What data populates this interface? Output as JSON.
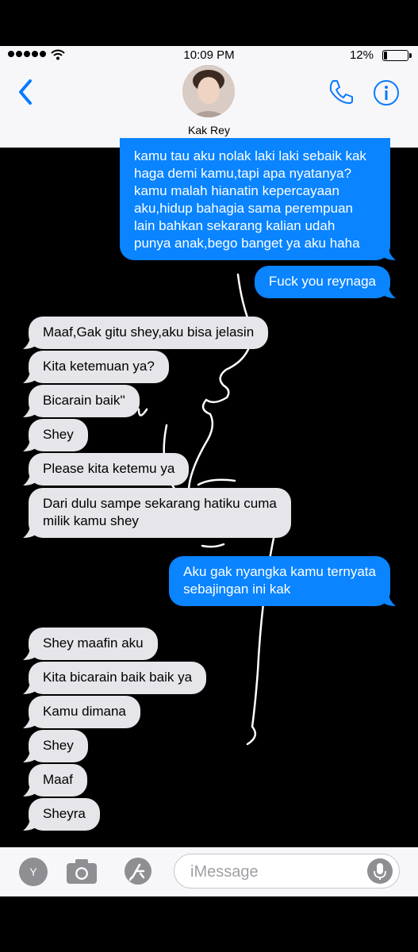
{
  "status_bar": {
    "time": "10:09 PM",
    "battery": "12%",
    "battery_level": 0.12
  },
  "header": {
    "contact_name": "Kak Rey",
    "back_icon": "chevron-left-icon",
    "call_icon": "phone-icon",
    "info_icon": "info-icon"
  },
  "messages": [
    {
      "from": "me",
      "text": "kamu tau aku nolak laki laki sebaik kak\nhaga demi kamu,tapi apa nyatanya?\nkamu malah hianatin kepercayaan\naku,hidup bahagia sama perempuan\nlain bahkan sekarang kalian udah\npunya anak,bego banget ya aku haha"
    },
    {
      "from": "me",
      "text": "Fuck you reynaga"
    },
    {
      "from": "them",
      "text": "Maaf,Gak gitu shey,aku bisa jelasin"
    },
    {
      "from": "them",
      "text": "Kita ketemuan ya?"
    },
    {
      "from": "them",
      "text": "Bicarain baik''"
    },
    {
      "from": "them",
      "text": "Shey"
    },
    {
      "from": "them",
      "text": "Please kita ketemu ya"
    },
    {
      "from": "them",
      "text": "Dari dulu sampe sekarang hatiku cuma\nmilik kamu shey"
    },
    {
      "from": "me",
      "text": "Aku gak nyangka kamu ternyata\nsebajingan ini kak"
    },
    {
      "from": "them",
      "text": "Shey maafin aku"
    },
    {
      "from": "them",
      "text": "Kita bicarain baik baik ya"
    },
    {
      "from": "them",
      "text": "Kamu dimana"
    },
    {
      "from": "them",
      "text": "Shey"
    },
    {
      "from": "them",
      "text": "Maaf"
    },
    {
      "from": "them",
      "text": "Sheyra"
    }
  ],
  "compose": {
    "app_label": "Y",
    "placeholder": "iMessage"
  },
  "colors": {
    "outgoing": "#0a84ff",
    "incoming": "#e5e5ea",
    "accent": "#0a7aff",
    "wallpaper": "#000000"
  }
}
